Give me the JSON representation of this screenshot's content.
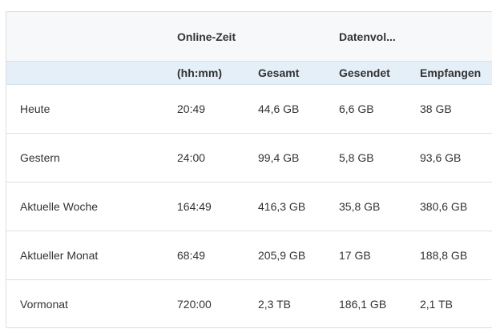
{
  "header": {
    "online_time": "Online-Zeit",
    "data_volume": "Datenvol..."
  },
  "subheader": {
    "hhmm": "(hh:mm)",
    "total": "Gesamt",
    "sent": "Gesendet",
    "received": "Empfangen"
  },
  "rows": [
    {
      "period": "Heute",
      "time": "20:49",
      "total": "44,6 GB",
      "sent": "6,6 GB",
      "received": "38 GB"
    },
    {
      "period": "Gestern",
      "time": "24:00",
      "total": "99,4 GB",
      "sent": "5,8 GB",
      "received": "93,6 GB"
    },
    {
      "period": "Aktuelle Woche",
      "time": "164:49",
      "total": "416,3 GB",
      "sent": "35,8 GB",
      "received": "380,6 GB"
    },
    {
      "period": "Aktueller Monat",
      "time": "68:49",
      "total": "205,9 GB",
      "sent": "17 GB",
      "received": "188,8 GB"
    },
    {
      "period": "Vormonat",
      "time": "720:00",
      "total": "2,3 TB",
      "sent": "186,1 GB",
      "received": "2,1 TB"
    }
  ]
}
